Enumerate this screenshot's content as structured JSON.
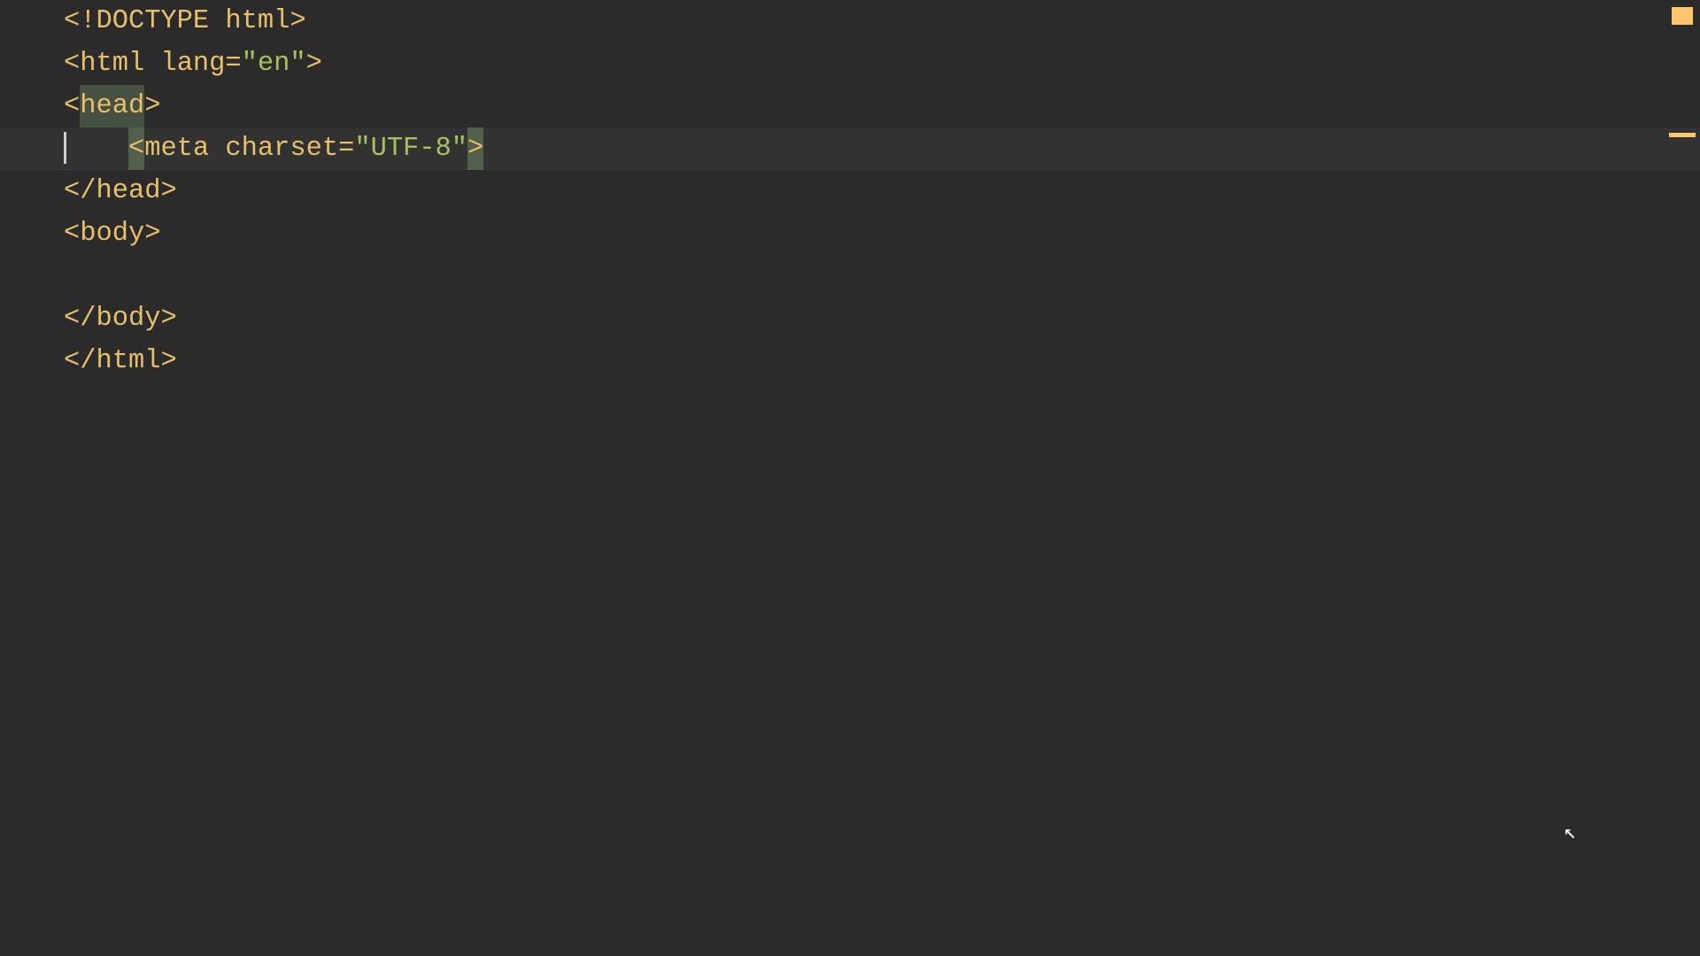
{
  "code": {
    "lines": [
      "<!DOCTYPE html>",
      "<html lang=\"en\">",
      "<head>",
      "    <meta charset=\"UTF-8\">",
      "</head>",
      "<body>",
      "",
      "</body>",
      "</html>"
    ],
    "active_line_index": 3,
    "matched_tag_text": "head",
    "matched_bracket_open": "<",
    "matched_bracket_close": ">"
  },
  "segments": {
    "l1": {
      "punct": "<!",
      "doctype": "DOCTYPE html",
      "close": ">"
    },
    "l2": {
      "open": "<",
      "tag": "html",
      "space": " ",
      "attr": "lang",
      "eq": "=",
      "q1": "\"",
      "val": "en",
      "q2": "\"",
      "close": ">"
    },
    "l3": {
      "open": "<",
      "tag": "head",
      "close": ">"
    },
    "l4": {
      "indent": "    ",
      "open": "<",
      "tag": "meta",
      "space": " ",
      "attr": "charset",
      "eq": "=",
      "q1": "\"",
      "val": "UTF-8",
      "q2": "\"",
      "close": ">"
    },
    "l5": {
      "open": "</",
      "tag": "head",
      "close": ">"
    },
    "l6": {
      "open": "<",
      "tag": "body",
      "close": ">"
    },
    "l8": {
      "open": "</",
      "tag": "body",
      "close": ">"
    },
    "l9": {
      "open": "</",
      "tag": "html",
      "close": ">"
    }
  }
}
